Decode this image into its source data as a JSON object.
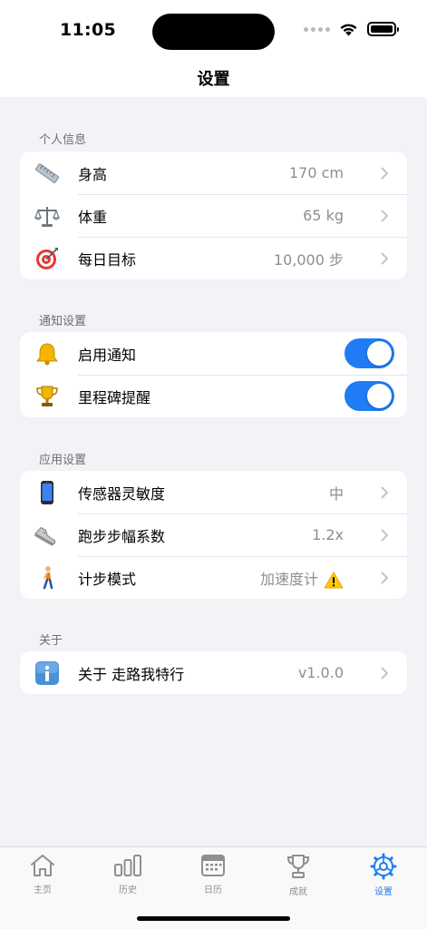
{
  "status_bar": {
    "time": "11:05"
  },
  "nav": {
    "title": "设置"
  },
  "sections": {
    "personal": {
      "header": "个人信息",
      "rows": [
        {
          "icon": "ruler-icon",
          "label": "身高",
          "value": "170 cm"
        },
        {
          "icon": "scale-icon",
          "label": "体重",
          "value": "65 kg"
        },
        {
          "icon": "target-icon",
          "label": "每日目标",
          "value": "10,000 步"
        }
      ]
    },
    "notifications": {
      "header": "通知设置",
      "rows": [
        {
          "icon": "bell-icon",
          "label": "启用通知",
          "enabled": true
        },
        {
          "icon": "trophy-icon",
          "label": "里程碑提醒",
          "enabled": true
        }
      ]
    },
    "app": {
      "header": "应用设置",
      "rows": [
        {
          "icon": "phone-icon",
          "label": "传感器灵敏度",
          "value": "中"
        },
        {
          "icon": "sneaker-icon",
          "label": "跑步步幅系数",
          "value": "1.2x"
        },
        {
          "icon": "walker-icon",
          "label": "计步模式",
          "value": "加速度计",
          "badge": "warning-icon"
        }
      ]
    },
    "about": {
      "header": "关于",
      "rows": [
        {
          "icon": "info-icon",
          "label": "关于 走路我特行",
          "value": "v1.0.0"
        }
      ]
    }
  },
  "tabbar": {
    "tabs": [
      {
        "icon": "house-icon",
        "label": "主页"
      },
      {
        "icon": "bar-chart-icon",
        "label": "历史"
      },
      {
        "icon": "calendar-icon",
        "label": "日历"
      },
      {
        "icon": "trophy-outline-icon",
        "label": "成就"
      },
      {
        "icon": "gear-icon",
        "label": "设置",
        "active": true
      }
    ]
  },
  "colors": {
    "accent": "#1f7cf4",
    "background": "#f2f2f7",
    "secondary_text": "#8e8e93"
  }
}
